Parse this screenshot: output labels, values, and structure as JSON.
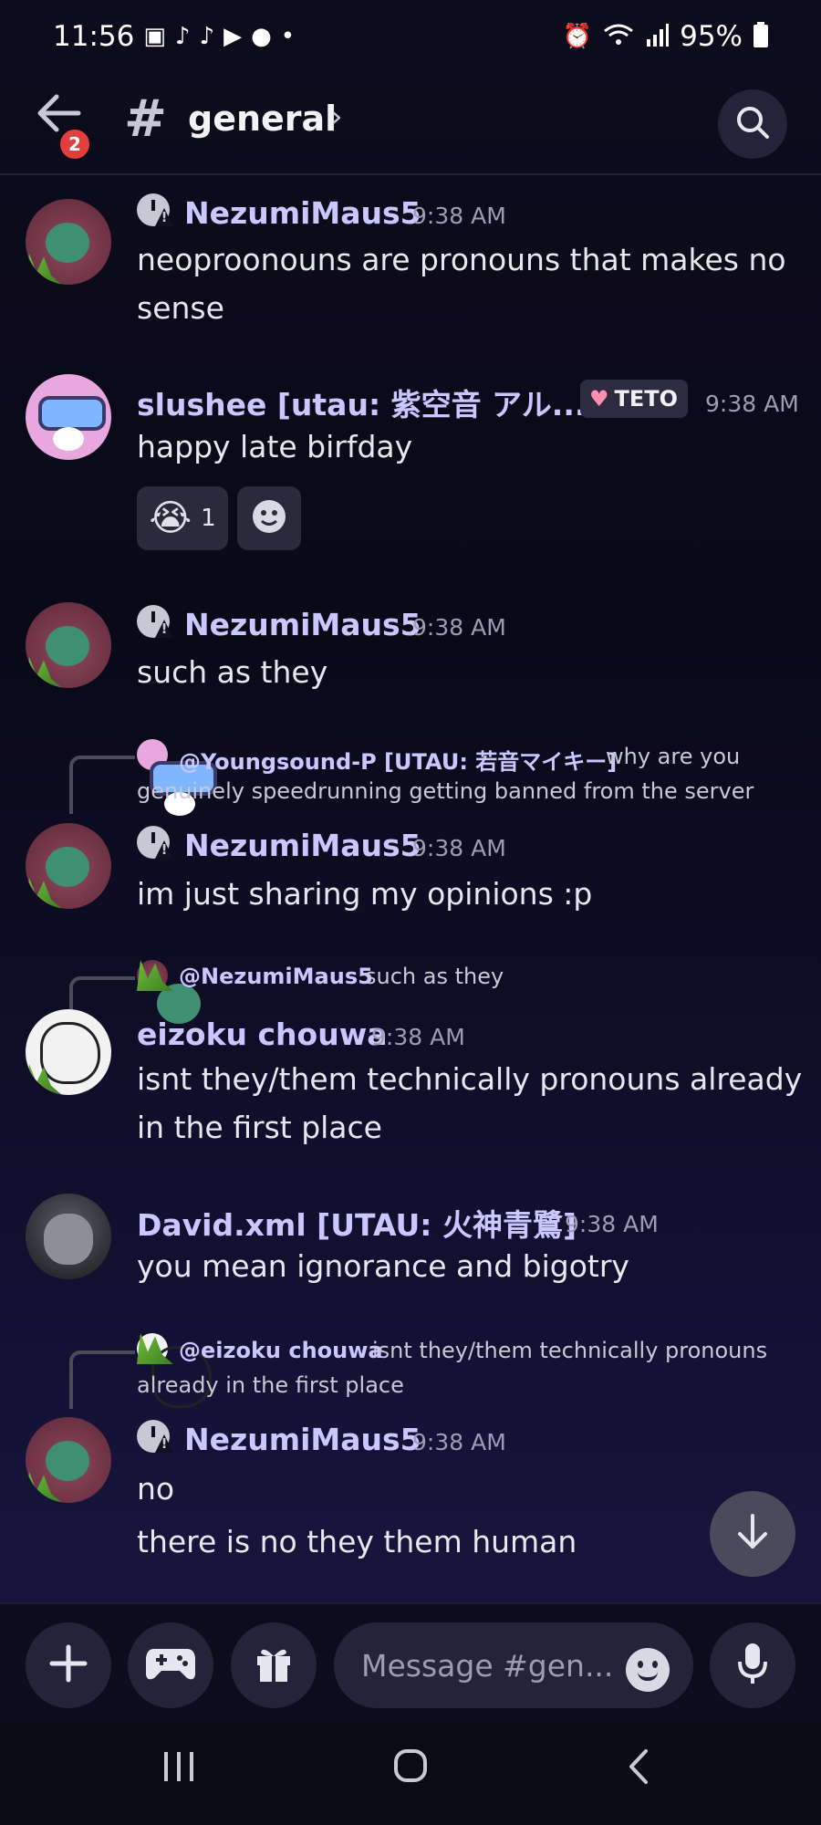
{
  "status_bar": {
    "time": "11:56",
    "notification_icons": [
      "app-icon",
      "tiktok-icon",
      "tiktok-icon",
      "youtube-icon",
      "reddit-icon",
      "dot-icon"
    ],
    "right_icons": [
      "alarm-icon",
      "wifi-icon",
      "signal-icon"
    ],
    "battery": "95%",
    "colors": {
      "text": "#ffffff"
    }
  },
  "header": {
    "badge_count": "2",
    "channel_symbol": "#",
    "channel_name": "general",
    "chevron": "›",
    "colors": {
      "badge": "#e23e3e",
      "background": "#0d0c1c"
    }
  },
  "messages": [
    {
      "author": "NezumiMaus5",
      "time": "9:38 AM",
      "lines": [
        "neoproonouns are pronouns that makes no",
        "sense"
      ]
    },
    {
      "author": "slushee [utau: 紫空音 アル...",
      "tag": "TETO",
      "time": "9:38 AM",
      "lines": [
        "happy late birfday"
      ],
      "reactions": [
        {
          "emoji": "😭",
          "count": "1"
        },
        {
          "emoji": "add-reaction-icon",
          "count": ""
        }
      ]
    },
    {
      "author": "NezumiMaus5",
      "time": "9:38 AM",
      "lines": [
        "such as they"
      ]
    },
    {
      "reply_to": {
        "name": "@Youngsound-P [UTAU: 若音マイキー]",
        "text_line1": "why are you",
        "text_line2": "genuinely speedrunning getting banned from the server"
      },
      "author": "NezumiMaus5",
      "time": "9:38 AM",
      "lines": [
        "im just sharing my opinions :p"
      ]
    },
    {
      "reply_to": {
        "name": "@NezumiMaus5",
        "text_line1": "such as they"
      },
      "author": "eizoku chouwa",
      "time": "9:38 AM",
      "lines": [
        "isnt they/them technically pronouns already",
        "in the first place"
      ]
    },
    {
      "author": "David.xml [UTAU: 火神青鷺]",
      "time": "9:38 AM",
      "lines": [
        "you mean ignorance and bigotry"
      ]
    },
    {
      "reply_to": {
        "name": "@eizoku chouwa",
        "text_line1": "isnt they/them technically pronouns",
        "text_line2": "already in the first place"
      },
      "author": "NezumiMaus5",
      "time": "9:38 AM",
      "lines": [
        "no",
        "there is no they them human"
      ]
    }
  ],
  "composer": {
    "placeholder": "Message #gen...",
    "buttons": [
      "plus-icon",
      "gamepad-icon",
      "gift-icon",
      "emoji-icon",
      "microphone-icon"
    ]
  },
  "nav": {
    "items": [
      "recent-apps-icon",
      "home-icon",
      "back-icon"
    ]
  },
  "colors": {
    "username": "#c9c7ff",
    "text": "#e7e8ef",
    "timestamp": "#9c9db0",
    "accent": "#23233a"
  }
}
